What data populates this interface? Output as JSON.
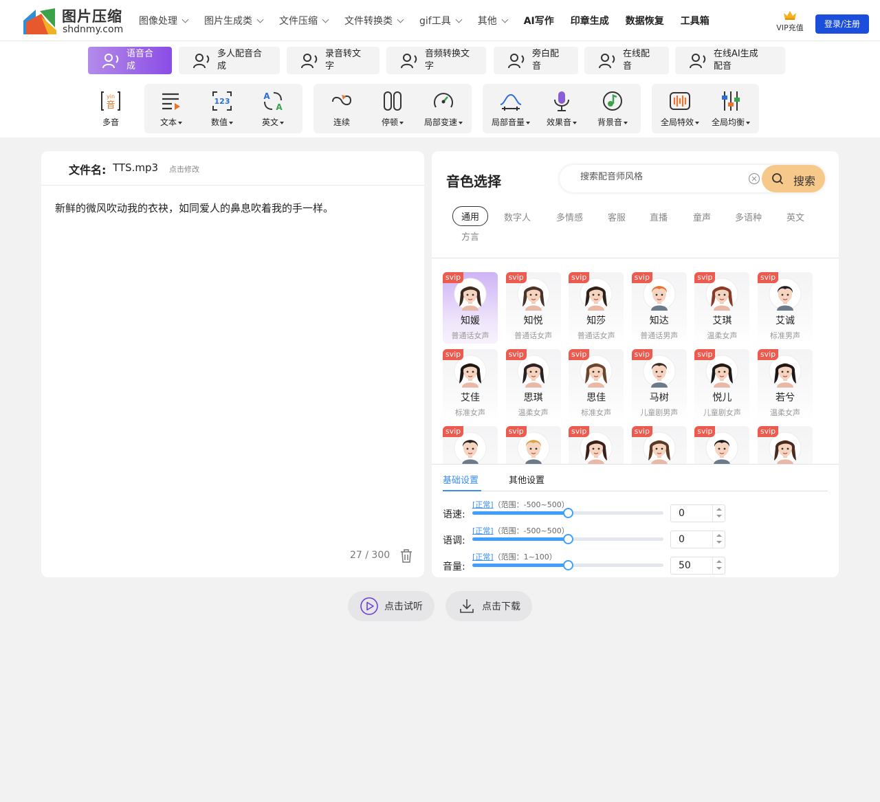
{
  "nav": {
    "logo_title": "图片压缩",
    "logo_domain": "shdnmy.com",
    "menu": [
      {
        "label": "图像处理",
        "dropdown": true
      },
      {
        "label": "图片生成类",
        "dropdown": true
      },
      {
        "label": "文件压缩",
        "dropdown": true
      },
      {
        "label": "文件转换类",
        "dropdown": true
      },
      {
        "label": "gif工具",
        "dropdown": true
      },
      {
        "label": "其他",
        "dropdown": true
      },
      {
        "label": "AI写作",
        "dropdown": false
      },
      {
        "label": "印章生成",
        "dropdown": false
      },
      {
        "label": "数据恢复",
        "dropdown": false
      },
      {
        "label": "工具箱",
        "dropdown": false
      }
    ],
    "vip_label": "VIP充值",
    "login_label": "登录/注册"
  },
  "function_tabs": [
    {
      "line1": "语音合",
      "line2": "成",
      "active": true
    },
    {
      "line1": "多人配音合",
      "line2": "成",
      "active": false
    },
    {
      "line1": "录音转文",
      "line2": "字",
      "active": false
    },
    {
      "line1": "音频转换文",
      "line2": "字",
      "active": false
    },
    {
      "line1": "旁白配",
      "line2": "音",
      "active": false
    },
    {
      "line1": "在线配",
      "line2": "音",
      "active": false
    },
    {
      "line1": "在线AI生成",
      "line2": "配音",
      "active": false
    }
  ],
  "toolbar": [
    {
      "label": "多音",
      "icon": "polyphone-icon",
      "dropdown": false
    },
    {
      "label": "文本",
      "icon": "text-icon",
      "dropdown": true
    },
    {
      "label": "数值",
      "icon": "number-icon",
      "dropdown": true
    },
    {
      "label": "英文",
      "icon": "english-icon",
      "dropdown": true
    },
    {
      "label": "连续",
      "icon": "continuous-icon",
      "dropdown": false
    },
    {
      "label": "停顿",
      "icon": "pause-icon",
      "dropdown": true
    },
    {
      "label": "局部变速",
      "icon": "speed-gauge-icon",
      "dropdown": true
    },
    {
      "label": "局部音量",
      "icon": "volume-wave-icon",
      "dropdown": true
    },
    {
      "label": "效果音",
      "icon": "microphone-icon",
      "dropdown": true
    },
    {
      "label": "背景音",
      "icon": "music-note-icon",
      "dropdown": true
    },
    {
      "label": "全局特效",
      "icon": "global-effect-icon",
      "dropdown": true
    },
    {
      "label": "全局均衡",
      "icon": "equalizer-icon",
      "dropdown": true
    }
  ],
  "editor": {
    "filename_label": "文件名:",
    "filename": "TTS.mp3",
    "edit_hint": "点击修改",
    "content": "新鲜的微风吹动我的衣袂，如同爱人的鼻息吹着我的手一样。",
    "char_count": "27 / 300"
  },
  "voice_panel": {
    "title": "音色选择",
    "search_placeholder": "搜索配音师风格",
    "search_button": "搜索",
    "categories": [
      "通用",
      "数字人",
      "多情感",
      "客服",
      "直播",
      "童声",
      "多语种",
      "英文",
      "方言"
    ],
    "active_category": "通用",
    "badge": "svip",
    "voices": [
      {
        "name": "知媛",
        "type": "普通话女声",
        "gender": "f",
        "hair": "#3a2a22",
        "selected": true
      },
      {
        "name": "知悦",
        "type": "普通话女声",
        "gender": "f",
        "hair": "#4a3328",
        "selected": false
      },
      {
        "name": "知莎",
        "type": "普通话女声",
        "gender": "f",
        "hair": "#2e211c",
        "selected": false
      },
      {
        "name": "知达",
        "type": "普通话男声",
        "gender": "m",
        "hair": "#e8742d",
        "selected": false
      },
      {
        "name": "艾琪",
        "type": "温柔女声",
        "gender": "f",
        "hair": "#8a3b2a",
        "selected": false
      },
      {
        "name": "艾诚",
        "type": "标准男声",
        "gender": "m",
        "hair": "#1f1f24",
        "selected": false
      },
      {
        "name": "艾佳",
        "type": "标准女声",
        "gender": "f",
        "hair": "#1d1716",
        "selected": false
      },
      {
        "name": "思琪",
        "type": "温柔女声",
        "gender": "f",
        "hair": "#2a2226",
        "selected": false
      },
      {
        "name": "思佳",
        "type": "标准女声",
        "gender": "f",
        "hair": "#6a4630",
        "selected": false
      },
      {
        "name": "马树",
        "type": "儿童剧男声",
        "gender": "m",
        "hair": "#3a2a24",
        "selected": false
      },
      {
        "name": "悦儿",
        "type": "儿童剧女声",
        "gender": "f",
        "hair": "#1e1a1a",
        "selected": false
      },
      {
        "name": "若兮",
        "type": "温柔女声",
        "gender": "f",
        "hair": "#1f1717",
        "selected": false
      },
      {
        "name": "",
        "type": "",
        "gender": "m",
        "hair": "#2b2322",
        "selected": false
      },
      {
        "name": "",
        "type": "",
        "gender": "m",
        "hair": "#d9a44a",
        "selected": false
      },
      {
        "name": "",
        "type": "",
        "gender": "f",
        "hair": "#3a1f1a",
        "selected": false
      },
      {
        "name": "",
        "type": "",
        "gender": "f",
        "hair": "#5a3a24",
        "selected": false
      },
      {
        "name": "",
        "type": "",
        "gender": "m",
        "hair": "#1c1c1c",
        "selected": false
      },
      {
        "name": "",
        "type": "",
        "gender": "f",
        "hair": "#4a2a1e",
        "selected": false
      }
    ]
  },
  "settings": {
    "tabs": [
      "基础设置",
      "其他设置"
    ],
    "active_tab": "基础设置",
    "rows": [
      {
        "label": "语速:",
        "tag": "[正常]",
        "range": "（范围：-500~500）",
        "value": "0",
        "fraction": 0.5
      },
      {
        "label": "语调:",
        "tag": "[正常]",
        "range": "（范围：-500~500）",
        "value": "0",
        "fraction": 0.5
      },
      {
        "label": "音量:",
        "tag": "[正常]",
        "range": "（范围：1~100）",
        "value": "50",
        "fraction": 0.5
      }
    ]
  },
  "actions": {
    "preview_label": "点击试听",
    "download_label": "点击下载"
  },
  "colors": {
    "accent_blue": "#409eff",
    "login_blue": "#1b4fdb",
    "active_tab_gradient_start": "#b38be8",
    "active_tab_gradient_end": "#8a4de6",
    "svip_badge": "#ee5b4e",
    "search_button": "#f6c88a"
  }
}
